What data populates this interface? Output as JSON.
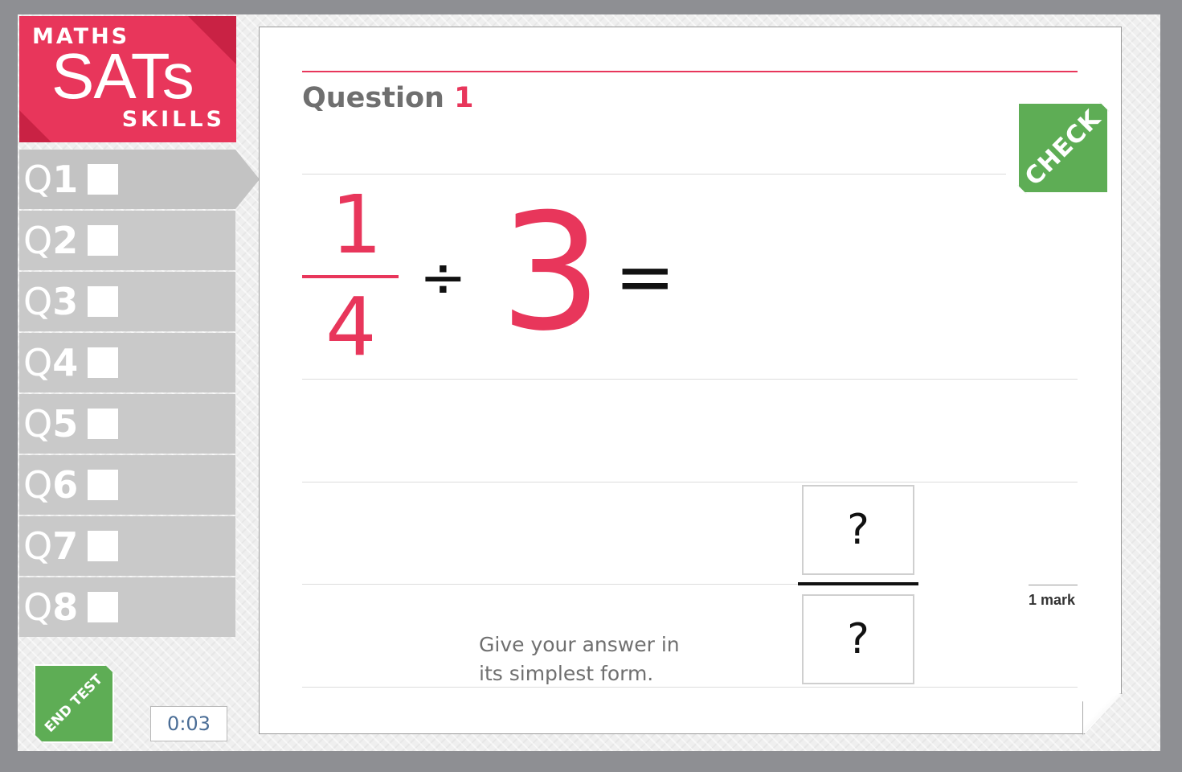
{
  "logo": {
    "line1": "MATHS",
    "line2": "SATs",
    "line3": "SKILLS"
  },
  "nav": {
    "items": [
      {
        "prefix": "Q",
        "number": "1",
        "active": true
      },
      {
        "prefix": "Q",
        "number": "2",
        "active": false
      },
      {
        "prefix": "Q",
        "number": "3",
        "active": false
      },
      {
        "prefix": "Q",
        "number": "4",
        "active": false
      },
      {
        "prefix": "Q",
        "number": "5",
        "active": false
      },
      {
        "prefix": "Q",
        "number": "6",
        "active": false
      },
      {
        "prefix": "Q",
        "number": "7",
        "active": false
      },
      {
        "prefix": "Q",
        "number": "8",
        "active": false
      }
    ]
  },
  "end_test_label": "END TEST",
  "timer": "0:03",
  "question": {
    "label": "Question",
    "number": "1",
    "check_label": "CHECK",
    "expression": {
      "numerator": "1",
      "denominator": "4",
      "operator": "÷",
      "operand": "3",
      "equals": "="
    },
    "answer": {
      "numerator_placeholder": "?",
      "denominator_placeholder": "?"
    },
    "marks": "1 mark",
    "hint_line1": "Give your answer in",
    "hint_line2": "its simplest form."
  },
  "colors": {
    "accent": "#e8365b",
    "button_green": "#5ead55",
    "background": "#8e8f93"
  }
}
